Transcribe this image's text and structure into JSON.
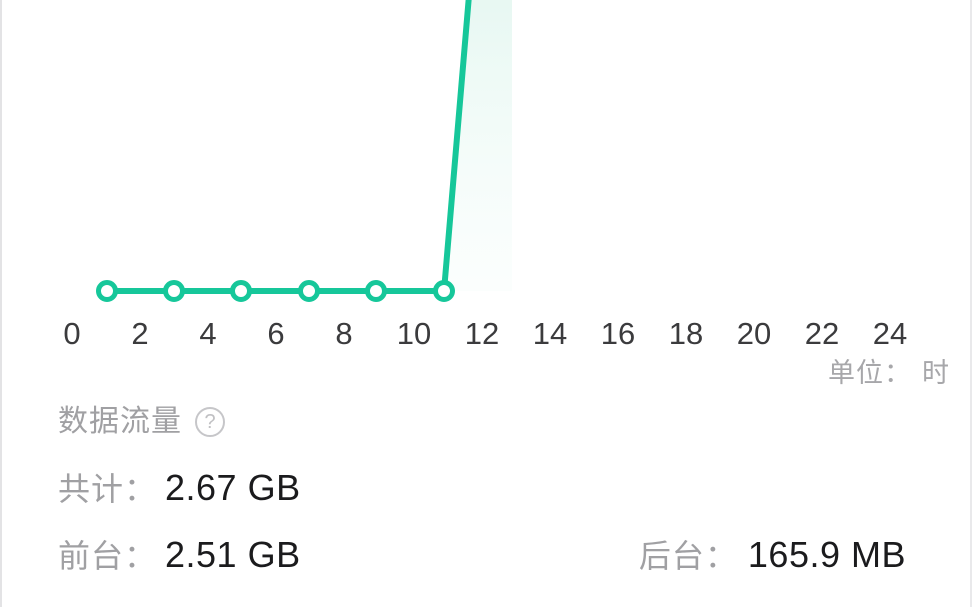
{
  "chart_data": {
    "type": "line",
    "title": "",
    "xlabel": "",
    "ylabel": "",
    "unit_note_label": "单位：",
    "unit_note_value": "时",
    "xlim": [
      0,
      24
    ],
    "ylim": [
      0,
      1
    ],
    "grid": false,
    "legend": null,
    "tick_labels": [
      "0",
      "2",
      "4",
      "6",
      "8",
      "10",
      "12",
      "14",
      "16",
      "18",
      "20",
      "22",
      "24"
    ],
    "tick_values": [
      0,
      2,
      4,
      6,
      8,
      10,
      12,
      14,
      16,
      18,
      20,
      22,
      24
    ],
    "series": [
      {
        "name": "数据流量",
        "color": "#16c79a",
        "fill_color": "#e8f8f3",
        "marker": "open-circle",
        "x": [
          1,
          3,
          5,
          7,
          9,
          11,
          12
        ],
        "values": [
          0,
          0,
          0,
          0,
          0,
          0,
          1
        ],
        "note": "flat near zero through hour 11, then a steep rise clipped at the top of the visible frame"
      }
    ]
  },
  "chart": {
    "line_color": "#16c79a",
    "marker_fill": "#ffffff",
    "area_fill": "#eaf8f4",
    "axis_label_color": "#3b3b3d",
    "background": "#ffffff"
  },
  "traffic": {
    "title": "数据流量",
    "help_icon": "?",
    "total": {
      "label": "共计：",
      "value": "2.67 GB"
    },
    "foreground": {
      "label": "前台：",
      "value": "2.51 GB"
    },
    "background": {
      "label": "后台：",
      "value": "165.9 MB"
    }
  }
}
